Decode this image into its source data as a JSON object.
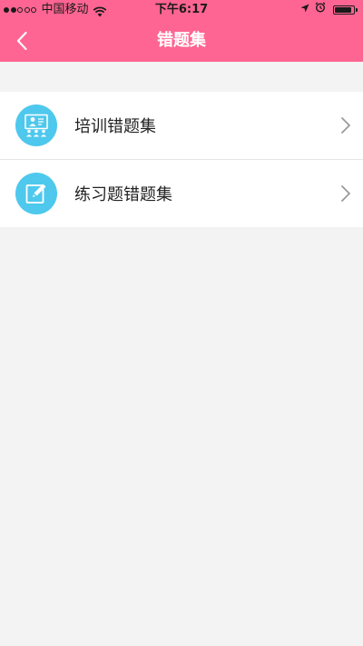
{
  "status_bar": {
    "carrier": "中国移动",
    "time": "下午6:17",
    "signal_filled": 2,
    "signal_total": 5,
    "battery_level": 0.9
  },
  "nav": {
    "title": "错题集",
    "back_icon": "chevron-left-icon"
  },
  "list": {
    "items": [
      {
        "label": "培训错题集",
        "icon": "training-presentation-icon"
      },
      {
        "label": "练习题错题集",
        "icon": "pencil-edit-icon"
      }
    ]
  },
  "colors": {
    "header": "#ff6592",
    "icon_circle": "#4ec8ed",
    "background": "#f3f3f3"
  }
}
